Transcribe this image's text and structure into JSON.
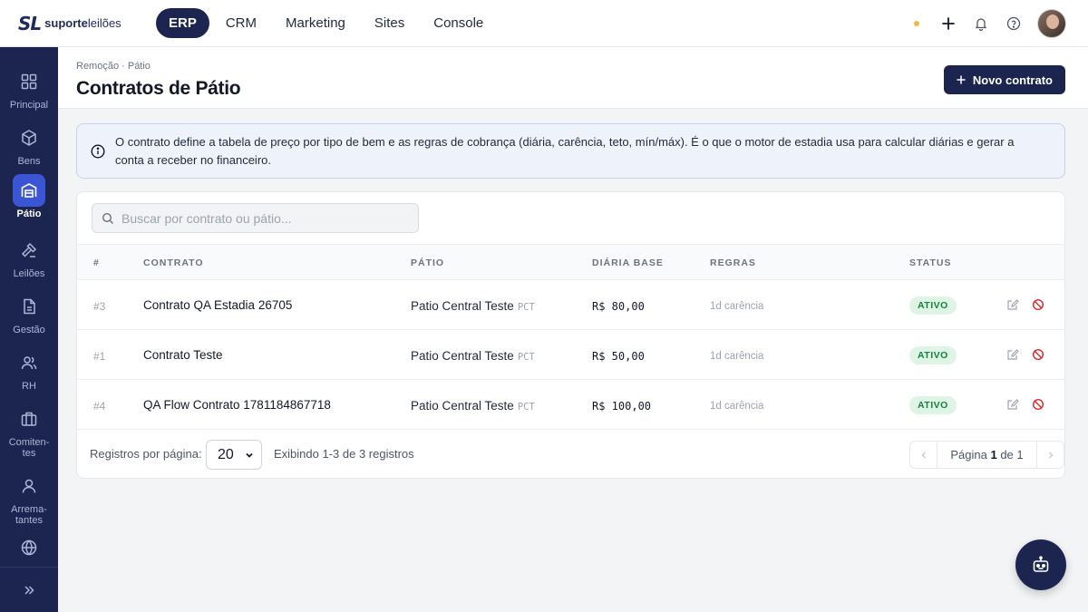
{
  "logo": {
    "mark": "SL",
    "brand_bold": "suporte",
    "brand_light": "leilões"
  },
  "nav": [
    {
      "label": "ERP",
      "active": true
    },
    {
      "label": "CRM",
      "active": false
    },
    {
      "label": "Marketing",
      "active": false
    },
    {
      "label": "Sites",
      "active": false
    },
    {
      "label": "Console",
      "active": false
    }
  ],
  "sidebar": {
    "items": [
      {
        "label": "Principal",
        "icon": "grid-icon"
      },
      {
        "label": "Bens",
        "icon": "box-icon"
      },
      {
        "label": "Pátio",
        "icon": "warehouse-icon",
        "active": true
      },
      {
        "label": "Leilões",
        "icon": "gavel-icon"
      },
      {
        "label": "Gestão",
        "icon": "document-icon"
      },
      {
        "label": "RH",
        "icon": "users-icon"
      },
      {
        "label": "Comiten-\ntes",
        "icon": "briefcase-icon"
      },
      {
        "label": "Arrema-\ntantes",
        "icon": "user-icon"
      },
      {
        "label": "",
        "icon": "globe-icon"
      }
    ]
  },
  "header": {
    "breadcrumb": "Remoção · Pátio",
    "title": "Contratos de Pátio",
    "new_button": "Novo contrato"
  },
  "info": {
    "text": "O contrato define a tabela de preço por tipo de bem e as regras de cobrança (diária, carência, teto, mín/máx). É o que o motor de estadia usa para calcular diárias e gerar a conta a receber no financeiro."
  },
  "search": {
    "placeholder": "Buscar por contrato ou pátio..."
  },
  "table": {
    "columns": [
      "#",
      "CONTRATO",
      "PÁTIO",
      "DIÁRIA BASE",
      "REGRAS",
      "STATUS"
    ],
    "rows": [
      {
        "num": "#3",
        "contract": "Contrato QA Estadia 26705",
        "patio": "Patio Central Teste",
        "patio_code": "PCT",
        "price": "R$ 80,00",
        "rule": "1d carência",
        "status": "ATIVO"
      },
      {
        "num": "#1",
        "contract": "Contrato Teste",
        "patio": "Patio Central Teste",
        "patio_code": "PCT",
        "price": "R$ 50,00",
        "rule": "1d carência",
        "status": "ATIVO"
      },
      {
        "num": "#4",
        "contract": "QA Flow Contrato 1781184867718",
        "patio": "Patio Central Teste",
        "patio_code": "PCT",
        "price": "R$ 100,00",
        "rule": "1d carência",
        "status": "ATIVO"
      }
    ]
  },
  "footer": {
    "rpp_label": "Registros por página:",
    "rpp_value": "20",
    "showing": "Exibindo 1-3 de 3 registros",
    "page_prefix": "Página",
    "page_current": "1",
    "page_sep": "de",
    "page_total": "1"
  },
  "colors": {
    "navy": "#1b2550",
    "active_blue": "#3a56d4",
    "success": "#15803d",
    "danger": "#dc2626"
  }
}
